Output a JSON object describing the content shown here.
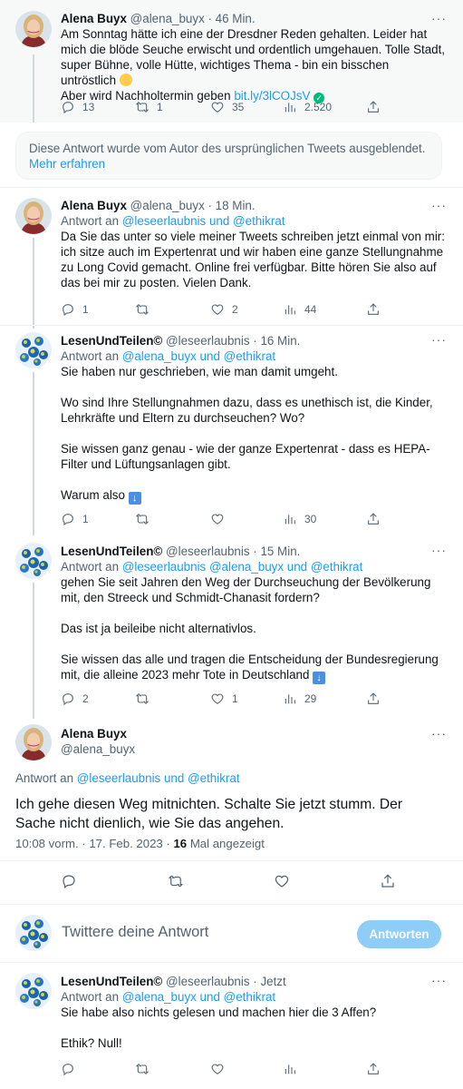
{
  "tweets": [
    {
      "name": "Alena Buyx",
      "handle": "@alena_buyx",
      "time": "· 46 Min.",
      "lines": [
        "Am Sonntag hätte ich eine der Dresdner Reden gehalten. Leider hat mich die blöde Seuche erwischt und ordentlich umgehauen. Tolle Stadt, super Bühne, volle Hütte, wichtiges Thema - bin ein bisschen untröstlich"
      ],
      "line2_prefix": "Aber wird Nachholtermin geben",
      "link": "bit.ly/3lCOJsV",
      "replies": "13",
      "retweets": "1",
      "likes": "35",
      "views": "2.520"
    },
    {
      "name": "Alena Buyx",
      "handle": "@alena_buyx",
      "time": "· 18 Min.",
      "reply_label": "Antwort an",
      "reply_targets": "@leseerlaubnis und @ethikrat",
      "text": "Da Sie das unter so viele meiner Tweets schreiben jetzt einmal von mir: ich sitze auch im Expertenrat und wir haben eine ganze Stellungnahme zu Long Covid gemacht. Online frei verfügbar. Bitte hören Sie also auf das bei mir zu posten. Vielen Dank.",
      "replies": "1",
      "retweets": "",
      "likes": "2",
      "views": "44"
    },
    {
      "name": "LesenUndTeilen©",
      "handle": "@leseerlaubnis",
      "time": "· 16 Min.",
      "reply_label": "Antwort an",
      "reply_targets": "@alena_buyx und @ethikrat",
      "p1": "Sie haben nur geschrieben, wie man damit umgeht.",
      "p2": "Wo sind Ihre Stellungnahmen dazu, dass es unethisch ist, die Kinder, Lehrkräfte und Eltern zu durchseuchen? Wo?",
      "p3": "Sie wissen ganz genau - wie der ganze Expertenrat - dass es HEPA-Filter und Lüftungsanlagen gibt.",
      "p4": "Warum also",
      "replies": "1",
      "retweets": "",
      "likes": "",
      "views": "30"
    },
    {
      "name": "LesenUndTeilen©",
      "handle": "@leseerlaubnis",
      "time": "· 15 Min.",
      "reply_label": "Antwort an",
      "reply_targets": "@leseerlaubnis @alena_buyx und @ethikrat",
      "p1": "gehen Sie seit Jahren den Weg der Durchseuchung der Bevölkerung mit, den Streeck und Schmidt-Chanasit fordern?",
      "p2": "Das ist ja beileibe nicht alternativlos.",
      "p3": "Sie wissen das alle und tragen die Entscheidung der Bundesregierung mit, die alleine 2023 mehr Tote in Deutschland",
      "replies": "2",
      "retweets": "",
      "likes": "1",
      "views": "29"
    }
  ],
  "hidden_notice": {
    "text": "Diese Antwort wurde vom Autor des ursprünglichen Tweets ausgeblendet.",
    "link": "Mehr erfahren"
  },
  "focus": {
    "name": "Alena Buyx",
    "handle": "@alena_buyx",
    "reply_label": "Antwort an",
    "reply_targets": "@leseerlaubnis und @ethikrat",
    "text": "Ich gehe diesen Weg mitnichten. Schalte Sie jetzt stumm. Der Sache nicht dienlich, wie Sie das angehen.",
    "timestamp": "10:08 vorm. · 17. Feb. 2023 ·",
    "views_count": "16",
    "views_label": "Mal angezeigt"
  },
  "compose": {
    "placeholder": "Twittere deine Antwort",
    "button": "Antworten"
  },
  "last_tweet": {
    "name": "LesenUndTeilen©",
    "handle": "@leseerlaubnis",
    "time": "· Jetzt",
    "reply_label": "Antwort an",
    "reply_targets": "@alena_buyx und @ethikrat",
    "p1": "Sie habe also nichts gelesen und machen hier die 3 Affen?",
    "p2": "Ethik? Null!"
  },
  "more_glyph": "···",
  "colors": {
    "accent": "#1d9bf0",
    "muted": "#536471",
    "verified": "#00ba7c",
    "reply_button": "#8ecdf8"
  },
  "icons": [
    "reply-icon",
    "retweet-icon",
    "like-icon",
    "views-icon",
    "share-icon",
    "more-icon",
    "verified-icon"
  ]
}
